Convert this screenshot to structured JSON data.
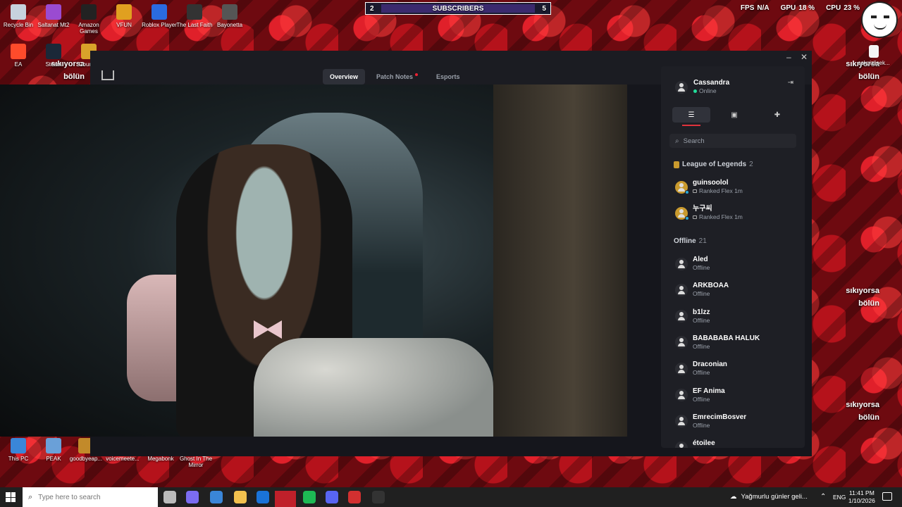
{
  "desktop": {
    "icons_top": [
      {
        "label": "Recycle Bin",
        "color": "#c7d2de"
      },
      {
        "label": "Saltanat Mt2",
        "color": "#9a4bd1"
      },
      {
        "label": "Amazon Games",
        "color": "#222222"
      },
      {
        "label": "VFUN",
        "color": "#e0a020"
      },
      {
        "label": "Roblox Player",
        "color": "#2a6be0"
      },
      {
        "label": "The Last Faith",
        "color": "#333333"
      },
      {
        "label": "Bayonetta",
        "color": "#555555"
      }
    ],
    "icons_second": [
      {
        "label": "EA",
        "color": "#ff4b2b"
      },
      {
        "label": "Steam",
        "color": "#1b2838"
      },
      {
        "label": "Counter",
        "color": "#d9a32a"
      }
    ],
    "icons_bottom": [
      {
        "label": "This PC",
        "color": "#3a86d8"
      },
      {
        "label": "PEAK",
        "color": "#6aa0d8"
      },
      {
        "label": "goodbyeap...",
        "color": "#c28a2a"
      },
      {
        "label": "voicemeete...",
        "color": "#333333"
      },
      {
        "label": "Megabonk",
        "color": "#444444"
      },
      {
        "label": "Ghost In The Mirror",
        "color": "#777777"
      }
    ],
    "right_icon_label": "cokgizlisek..."
  },
  "overlay": {
    "subscribers_label": "SUBSCRIBERS",
    "subscribers_left": "2",
    "subscribers_right": "5",
    "fps_label": "FPS",
    "fps_value": "N/A",
    "gpu_label": "GPU",
    "gpu_value": "18 %",
    "cpu_label": "CPU",
    "cpu_value": "23 %"
  },
  "wallpaper_text": [
    {
      "line1": "sıkıyorsa",
      "line2": "bölün"
    },
    {
      "line1": "sıkıyorsa",
      "line2": "bölün"
    },
    {
      "line1": "sıkıyorsa",
      "line2": "bölün"
    },
    {
      "line1": "sıkıyorsa",
      "line2": "bölün"
    }
  ],
  "client": {
    "tabs": [
      {
        "label": "Overview"
      },
      {
        "label": "Patch Notes"
      },
      {
        "label": "Esports"
      }
    ]
  },
  "panel": {
    "user_name": "Cassandra",
    "user_status": "Online",
    "search_placeholder": "Search",
    "group_lol": "League of Legends",
    "group_lol_count": "2",
    "ingame": [
      {
        "name": "guinsoolol",
        "status": "Ranked Flex 1m"
      },
      {
        "name": "누구씨",
        "status": "Ranked Flex 1m"
      }
    ],
    "group_offline": "Offline",
    "group_offline_count": "21",
    "offline": [
      {
        "name": "Aled",
        "status": "Offline"
      },
      {
        "name": "ARKBOAA",
        "status": "Offline"
      },
      {
        "name": "b1lzz",
        "status": "Offline"
      },
      {
        "name": "BABABABA HALUK",
        "status": "Offline"
      },
      {
        "name": "Draconian",
        "status": "Offline"
      },
      {
        "name": "EF Anima",
        "status": "Offline"
      },
      {
        "name": "EmrecimBosver",
        "status": "Offline"
      },
      {
        "name": "étoilee",
        "status": "Offline"
      }
    ]
  },
  "taskbar": {
    "search_placeholder": "Type here to search",
    "weather": "Yağmurlu günler geli...",
    "lang": "ENG",
    "time": "11:41 PM",
    "date": "1/10/2026",
    "apps": [
      {
        "name": "task-view",
        "color": "#bbbbbb"
      },
      {
        "name": "copilot",
        "color": "#7b6cf0"
      },
      {
        "name": "store",
        "color": "#3a86d8"
      },
      {
        "name": "file-explorer",
        "color": "#f2c14e"
      },
      {
        "name": "outlook",
        "color": "#1a73d8"
      },
      {
        "name": "active-app",
        "color": "#c0202a"
      },
      {
        "name": "spotify",
        "color": "#1db954"
      },
      {
        "name": "discord",
        "color": "#5865f2"
      },
      {
        "name": "game-app",
        "color": "#d23030"
      },
      {
        "name": "obs",
        "color": "#333333"
      }
    ]
  }
}
